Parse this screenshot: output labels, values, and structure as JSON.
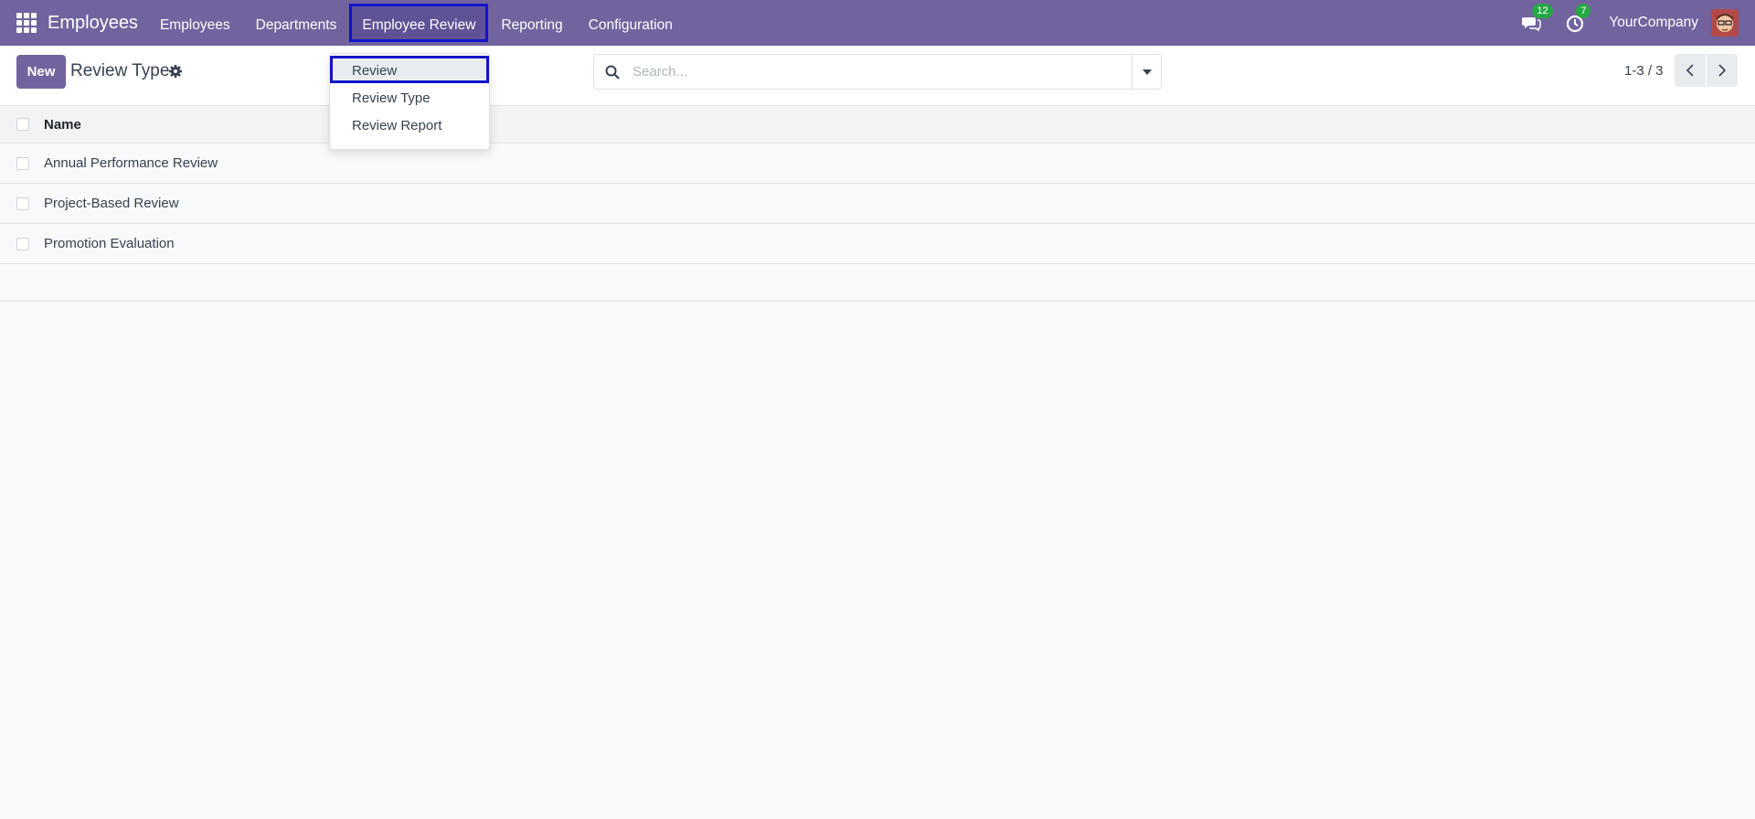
{
  "navbar": {
    "app_title": "Employees",
    "menu": [
      "Employees",
      "Departments",
      "Employee Review",
      "Reporting",
      "Configuration"
    ],
    "active_menu": "Employee Review",
    "messages_count": "12",
    "activities_count": "7",
    "company": "YourCompany"
  },
  "control": {
    "new_label": "New",
    "breadcrumb": "Review Type",
    "search_placeholder": "Search...",
    "pager": "1-3 / 3"
  },
  "list": {
    "column": "Name",
    "rows": [
      "Annual Performance Review",
      "Project-Based Review",
      "Promotion Evaluation"
    ]
  },
  "dropdown": {
    "items": [
      "Review",
      "Review Type",
      "Review Report"
    ]
  },
  "colors": {
    "navbar": "#71639e",
    "highlight": "#1313c9",
    "badge": "#28a745"
  }
}
